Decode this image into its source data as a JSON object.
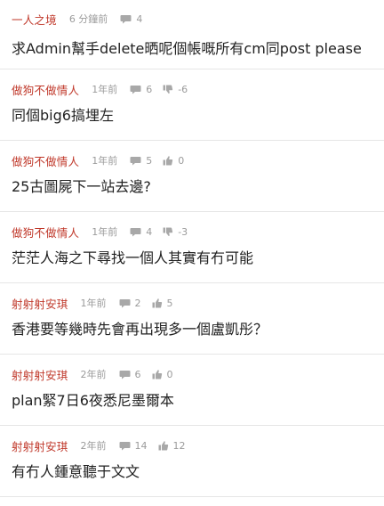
{
  "comments": [
    {
      "author": "一人之境",
      "time": "6 分鐘前",
      "replies": "4",
      "likes": null,
      "like_type": null,
      "text": "求Admin幫手delete晒呢個帳嘅所有cm同post please"
    },
    {
      "author": "做狗不做情人",
      "time": "1年前",
      "replies": "6",
      "likes": "-6",
      "like_type": "thumbs-down-icon",
      "text": "同個big6搞埋左"
    },
    {
      "author": "做狗不做情人",
      "time": "1年前",
      "replies": "5",
      "likes": "0",
      "like_type": "thumbs-up-icon",
      "text": "25古圖屍下一站去邊?"
    },
    {
      "author": "做狗不做情人",
      "time": "1年前",
      "replies": "4",
      "likes": "-3",
      "like_type": "thumbs-down-icon",
      "text": "茫茫人海之下尋找一個人其實有冇可能"
    },
    {
      "author": "射射射安琪",
      "time": "1年前",
      "replies": "2",
      "likes": "5",
      "like_type": "thumbs-up-icon",
      "text": "香港要等幾時先會再出現多一個盧凱彤？"
    },
    {
      "author": "射射射安琪",
      "time": "2年前",
      "replies": "6",
      "likes": "0",
      "like_type": "thumbs-up-icon",
      "text": "plan緊7日6夜悉尼墨爾本"
    },
    {
      "author": "射射射安琪",
      "time": "2年前",
      "replies": "14",
      "likes": "12",
      "like_type": "thumbs-up-icon",
      "text": "有冇人鍾意聽于文文"
    }
  ],
  "colors": {
    "author": "#c0392b",
    "meta": "#9b9b9b",
    "text": "#222222",
    "divider": "#e6e6e6"
  }
}
